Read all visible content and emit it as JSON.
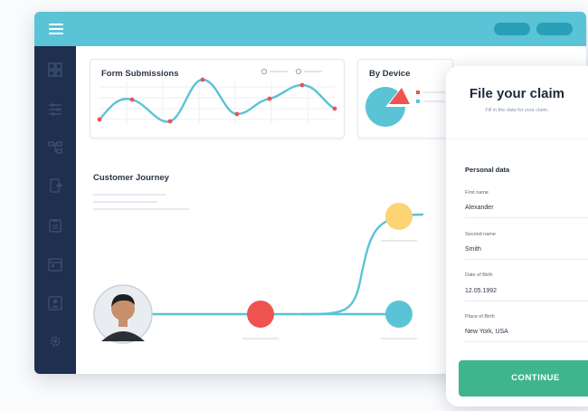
{
  "dashboard": {
    "form_submissions": {
      "title": "Form Submissions"
    },
    "by_device": {
      "title": "By Device"
    },
    "customer_journey": {
      "title": "Customer Journey"
    }
  },
  "claim_form": {
    "title": "File your claim",
    "subtitle": "Fill in the data for your claim.",
    "section": "Personal data",
    "fields": [
      {
        "label": "First name",
        "value": "Alexander"
      },
      {
        "label": "Second name",
        "value": "Smith"
      },
      {
        "label": "Date of Birth",
        "value": "12.05.1992"
      },
      {
        "label": "Place of Birth",
        "value": "New York, USA"
      }
    ],
    "button": "CONTINUE"
  },
  "colors": {
    "topbar": "#5bc3d6",
    "sidebar": "#1f2f50",
    "accent": "#5bc3d6",
    "red": "#ef5350",
    "yellow": "#fdd474",
    "green_button": "#3fb58e"
  },
  "icons": [
    "menu-icon",
    "dashboard-icon",
    "sliders-icon",
    "flow-icon",
    "export-icon",
    "clipboard-icon",
    "calendar-icon",
    "contact-icon",
    "gear-icon"
  ]
}
